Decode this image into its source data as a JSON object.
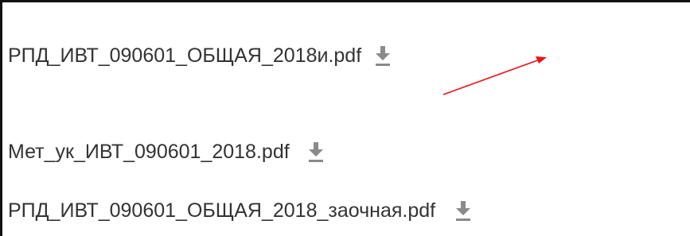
{
  "files": [
    {
      "name": "РПД_ИВТ_090601_ОБЩАЯ_2018и.pdf",
      "action_icon": "download-icon"
    },
    {
      "name": "Мет_ук_ИВТ_090601_2018.pdf",
      "action_icon": "download-icon"
    },
    {
      "name": "РПД_ИВТ_090601_ОБЩАЯ_2018_заочная.pdf",
      "action_icon": "download-icon"
    }
  ],
  "colors": {
    "text": "#333333",
    "icon": "#8a8a8a",
    "annotation_arrow": "#e8141b",
    "frame": "#111111"
  }
}
